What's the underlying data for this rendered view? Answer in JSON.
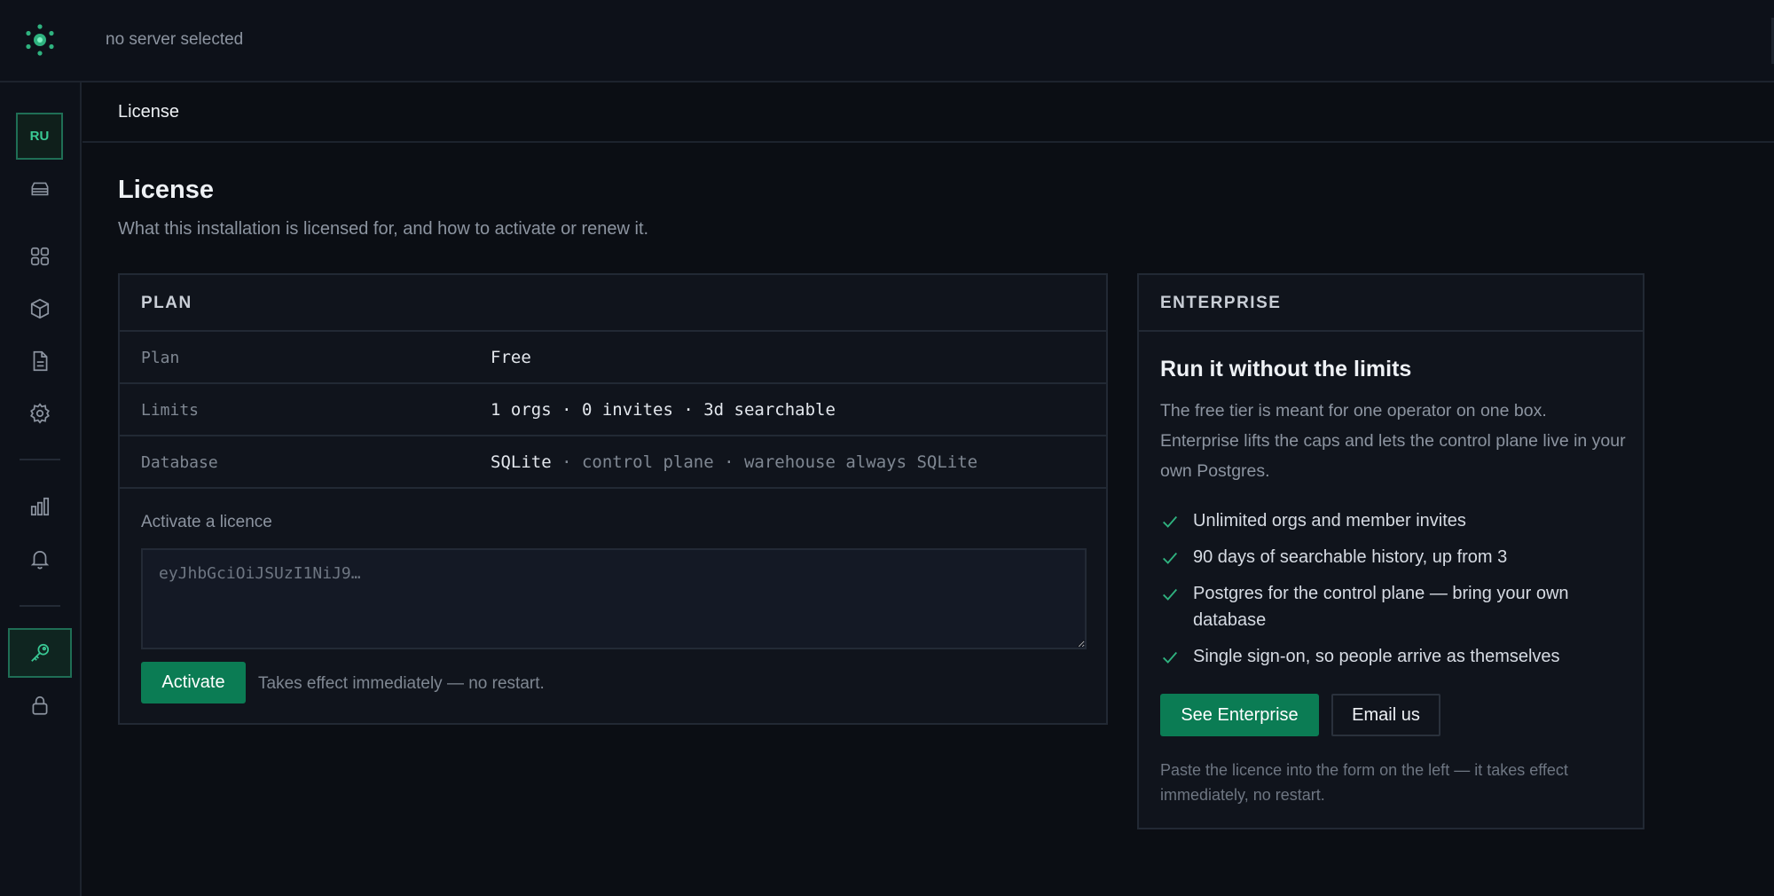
{
  "topbar": {
    "server_status": "no server selected"
  },
  "sidebar": {
    "avatar_initials": "RU",
    "items": [
      {
        "name": "servers",
        "icon": "server-icon"
      },
      {
        "name": "dashboard",
        "icon": "grid-icon"
      },
      {
        "name": "packages",
        "icon": "cube-icon"
      },
      {
        "name": "logs",
        "icon": "document-icon"
      },
      {
        "name": "settings",
        "icon": "gear-icon"
      },
      {
        "name": "metrics",
        "icon": "bar-chart-icon"
      },
      {
        "name": "alerts",
        "icon": "bell-icon"
      },
      {
        "name": "license",
        "icon": "key-icon",
        "active": true
      },
      {
        "name": "security",
        "icon": "lock-icon"
      }
    ]
  },
  "page": {
    "breadcrumb": "License",
    "title": "License",
    "subtitle": "What this installation is licensed for, and how to activate or renew it."
  },
  "plan": {
    "heading": "PLAN",
    "rows": [
      {
        "label": "Plan",
        "value": "Free",
        "detail": ""
      },
      {
        "label": "Limits",
        "value": "1 orgs · 0 invites · 3d searchable",
        "detail": ""
      },
      {
        "label": "Database",
        "value": "SQLite",
        "detail": " · control plane · warehouse always SQLite"
      }
    ],
    "activate_label": "Activate a licence",
    "input_placeholder": "eyJhbGciOiJSUzI1NiJ9…",
    "activate_button": "Activate",
    "activate_hint": "Takes effect immediately — no restart."
  },
  "enterprise": {
    "heading": "ENTERPRISE",
    "title": "Run it without the limits",
    "description": "The free tier is meant for one operator on one box. Enterprise lifts the caps and lets the control plane live in your own Postgres.",
    "features": [
      "Unlimited orgs and member invites",
      "90 days of searchable history, up from 3",
      "Postgres for the control plane — bring your own database",
      "Single sign-on, so people arrive as themselves"
    ],
    "see_button": "See Enterprise",
    "email_button": "Email us",
    "footnote": "Paste the licence into the form on the left — it takes effect immediately, no restart."
  },
  "colors": {
    "accent": "#0b7c54",
    "accent_text": "#39c994",
    "background": "#0b0e14",
    "card": "#10141c"
  }
}
